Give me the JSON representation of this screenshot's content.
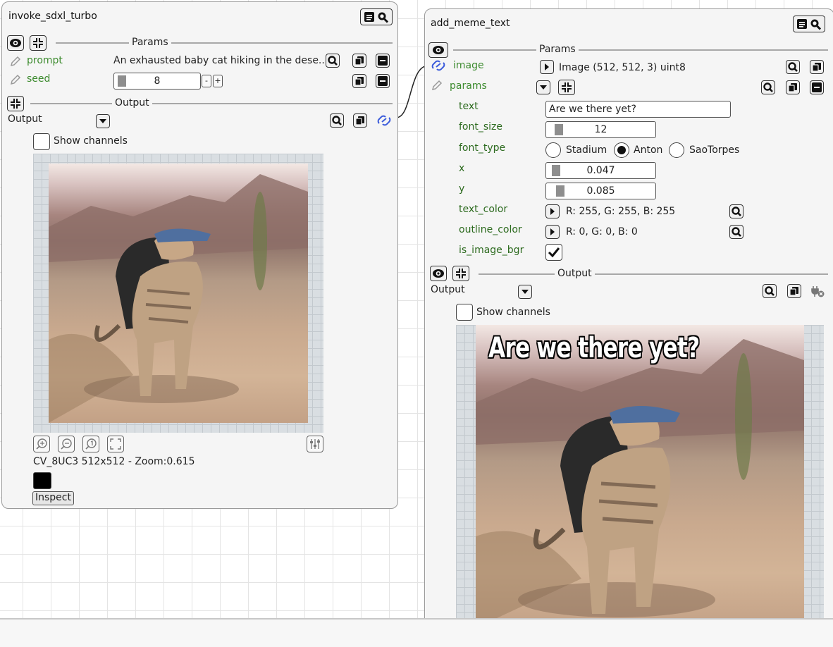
{
  "left_node": {
    "title": "invoke_sdxl_turbo",
    "params_header": "Params",
    "params": [
      {
        "name": "prompt",
        "value": "An exhausted baby cat hiking in the dese..."
      },
      {
        "name": "seed",
        "value": "8"
      }
    ],
    "seed_minus": "-",
    "seed_plus": "+",
    "output_header": "Output",
    "output_label": "Output",
    "show_channels": "Show channels",
    "image_info": "CV_8UC3 512x512 - Zoom:0.615",
    "inspect_label": "Inspect"
  },
  "right_node": {
    "title": "add_meme_text",
    "params_header": "Params",
    "image_input_label": "image",
    "image_input_value": "Image (512, 512, 3) uint8",
    "params_label": "params",
    "fields": {
      "text": {
        "label": "text",
        "value": "Are we there yet?"
      },
      "font_size": {
        "label": "font_size",
        "value": "12",
        "level": 0.12
      },
      "font_type": {
        "label": "font_type",
        "options": [
          "Stadium",
          "Anton",
          "SaoTorpes"
        ],
        "selected": "Anton"
      },
      "x": {
        "label": "x",
        "value": "0.047",
        "level": 0.047
      },
      "y": {
        "label": "y",
        "value": "0.085",
        "level": 0.085
      },
      "text_color": {
        "label": "text_color",
        "value": "R: 255, G: 255, B: 255"
      },
      "outline_color": {
        "label": "outline_color",
        "value": "R: 0, G: 0, B: 0"
      },
      "is_image_bgr": {
        "label": "is_image_bgr",
        "checked": true
      }
    },
    "output_header": "Output",
    "output_label": "Output",
    "show_channels": "Show channels",
    "meme_text": "Are we there yet?"
  },
  "colors": {
    "param_label_green": "#3d8b2f",
    "link_blue": "#3b5bdb",
    "node_bg": "#f5f5f5"
  },
  "icons": [
    "eye-icon",
    "collapse-icon",
    "magnifier-icon",
    "copy-icon",
    "minus-icon",
    "link-icon",
    "pencil-icon",
    "triangle-right-icon",
    "triangle-down-icon",
    "checkmark-icon",
    "zoom-in-icon",
    "zoom-out-icon",
    "zoom-reset-icon",
    "fit-icon",
    "levels-icon",
    "doc-search-icon",
    "unplug-icon"
  ]
}
